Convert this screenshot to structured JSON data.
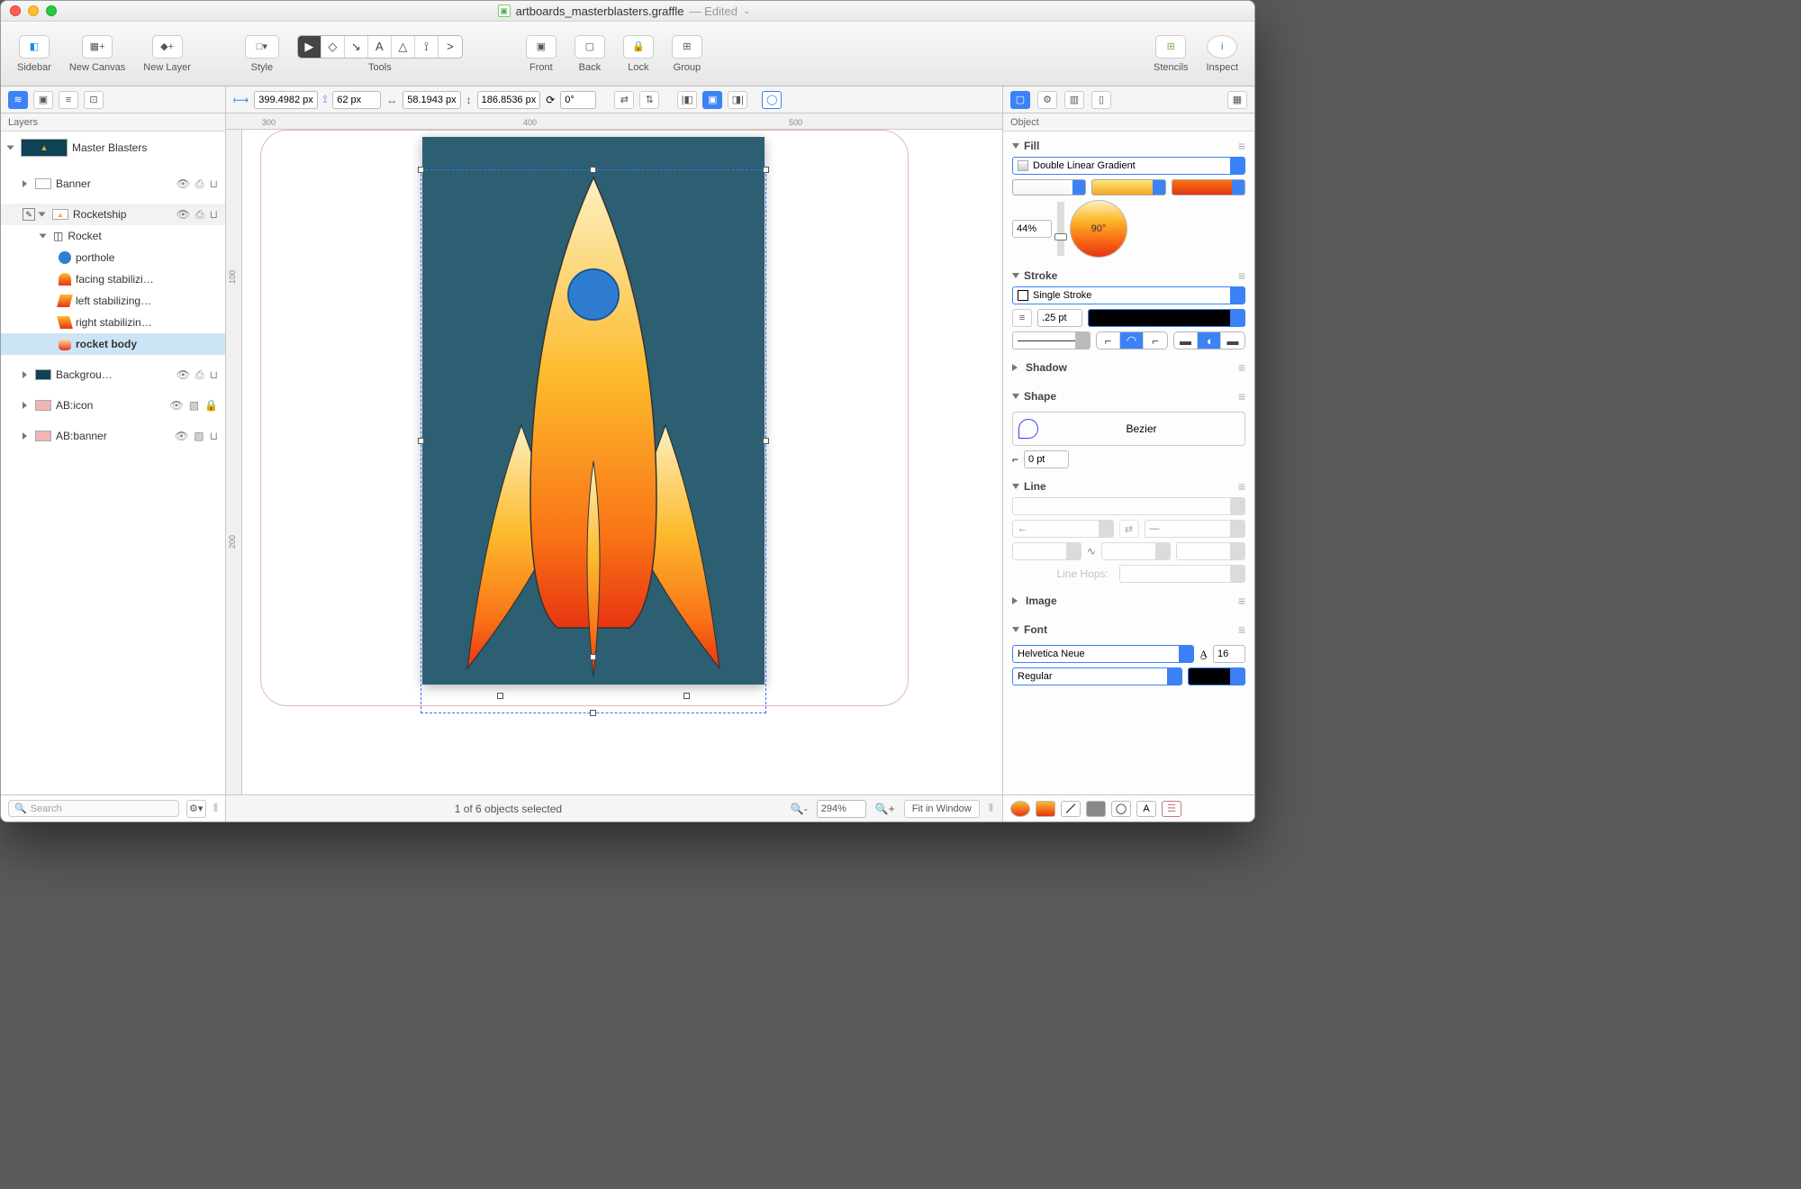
{
  "title": {
    "filename": "artboards_masterblasters.graffle",
    "status": "— Edited"
  },
  "toolbar": {
    "sidebar": "Sidebar",
    "new_canvas": "New Canvas",
    "new_layer": "New Layer",
    "style": "Style",
    "tools": "Tools",
    "front": "Front",
    "back": "Back",
    "lock": "Lock",
    "group": "Group",
    "stencils": "Stencils",
    "inspect": "Inspect"
  },
  "geom": {
    "x": "399.4982 px",
    "y": "62 px",
    "w": "58.1943 px",
    "h": "186.8536 px",
    "rot": "0°"
  },
  "sidebar": {
    "tab": "Layers",
    "canvas": "Master Blasters",
    "layers": [
      {
        "name": "Banner",
        "icons": [
          "eye",
          "print",
          "lock-open"
        ]
      },
      {
        "name": "Rocketship",
        "icons": [
          "eye",
          "print",
          "lock-open"
        ],
        "editing": true,
        "open": true,
        "children": [
          {
            "name": "Rocket",
            "open": true,
            "children": [
              {
                "name": "porthole"
              },
              {
                "name": "facing stabilizi…"
              },
              {
                "name": "left stabilizing…"
              },
              {
                "name": "right stabilizin…"
              },
              {
                "name": "rocket body",
                "selected": true,
                "bold": true
              }
            ]
          }
        ]
      },
      {
        "name": "Backgrou…",
        "swatch": "#0d4354",
        "icons": [
          "eye",
          "print",
          "lock-open"
        ]
      },
      {
        "name": "AB:icon",
        "swatch": "#f2b4b4",
        "icons": [
          "eye",
          "artboard",
          "lock"
        ]
      },
      {
        "name": "AB:banner",
        "swatch": "#f2b4b4",
        "icons": [
          "eye",
          "artboard",
          "lock-open"
        ]
      }
    ],
    "search": "Search"
  },
  "ruler": {
    "h": [
      "300",
      "400",
      "500"
    ],
    "v": [
      "100",
      "200"
    ]
  },
  "statusbar": {
    "selection": "1 of 6 objects selected",
    "zoom": "294%",
    "fit": "Fit in Window"
  },
  "inspector": {
    "tab": "Object",
    "fill": {
      "title": "Fill",
      "type": "Double Linear Gradient",
      "pct": "44%",
      "angle": "90°"
    },
    "stroke": {
      "title": "Stroke",
      "type": "Single Stroke",
      "width": ".25 pt"
    },
    "shadow": {
      "title": "Shadow"
    },
    "shape": {
      "title": "Shape",
      "type": "Bezier",
      "radius": "0 pt"
    },
    "line": {
      "title": "Line",
      "hops": "Line Hops:"
    },
    "image": {
      "title": "Image"
    },
    "font": {
      "title": "Font",
      "family": "Helvetica Neue",
      "size": "16",
      "weight": "Regular"
    }
  }
}
